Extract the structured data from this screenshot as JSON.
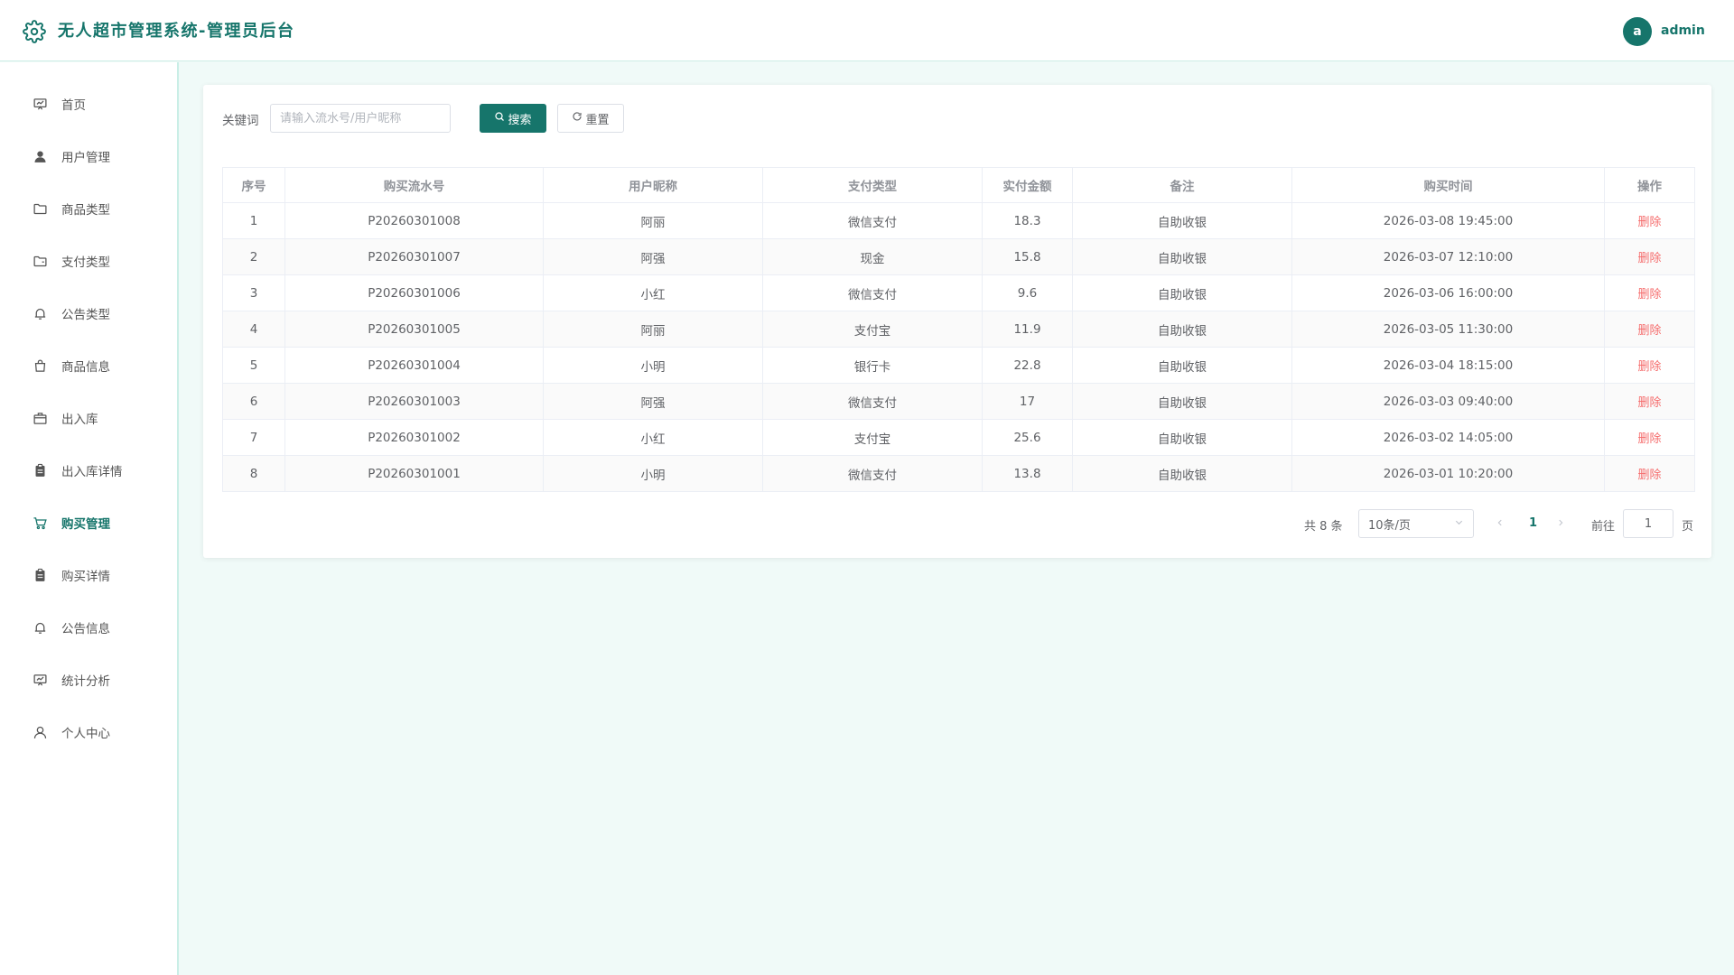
{
  "header": {
    "title": "无人超市管理系统-管理员后台",
    "avatar_letter": "a",
    "username": "admin"
  },
  "sidebar": {
    "items": [
      {
        "label": "首页",
        "icon": "presentation-board-icon"
      },
      {
        "label": "用户管理",
        "icon": "user-filled-icon"
      },
      {
        "label": "商品类型",
        "icon": "folder-icon"
      },
      {
        "label": "支付类型",
        "icon": "folder-opened-icon"
      },
      {
        "label": "公告类型",
        "icon": "bell-icon"
      },
      {
        "label": "商品信息",
        "icon": "shopping-bag-icon"
      },
      {
        "label": "出入库",
        "icon": "box-icon"
      },
      {
        "label": "出入库详情",
        "icon": "clipboard-icon"
      },
      {
        "label": "购买管理",
        "icon": "shopping-cart-icon",
        "active": true
      },
      {
        "label": "购买详情",
        "icon": "clipboard-icon"
      },
      {
        "label": "公告信息",
        "icon": "bell-icon"
      },
      {
        "label": "统计分析",
        "icon": "presentation-board-icon"
      },
      {
        "label": "个人中心",
        "icon": "user-icon"
      }
    ]
  },
  "search": {
    "label": "关键词",
    "placeholder": "请输入流水号/用户昵称",
    "value": "",
    "search_label": "搜索",
    "reset_label": "重置"
  },
  "table": {
    "headers": [
      "序号",
      "购买流水号",
      "用户昵称",
      "支付类型",
      "实付金额",
      "备注",
      "购买时间",
      "操作"
    ],
    "rows": [
      {
        "no": "1",
        "serial": "P20260301008",
        "nickname": "阿丽",
        "pay_type": "微信支付",
        "amount": "18.3",
        "remark": "自助收银",
        "time": "2026-03-08 19:45:00",
        "action": "删除"
      },
      {
        "no": "2",
        "serial": "P20260301007",
        "nickname": "阿强",
        "pay_type": "现金",
        "amount": "15.8",
        "remark": "自助收银",
        "time": "2026-03-07 12:10:00",
        "action": "删除"
      },
      {
        "no": "3",
        "serial": "P20260301006",
        "nickname": "小红",
        "pay_type": "微信支付",
        "amount": "9.6",
        "remark": "自助收银",
        "time": "2026-03-06 16:00:00",
        "action": "删除"
      },
      {
        "no": "4",
        "serial": "P20260301005",
        "nickname": "阿丽",
        "pay_type": "支付宝",
        "amount": "11.9",
        "remark": "自助收银",
        "time": "2026-03-05 11:30:00",
        "action": "删除"
      },
      {
        "no": "5",
        "serial": "P20260301004",
        "nickname": "小明",
        "pay_type": "银行卡",
        "amount": "22.8",
        "remark": "自助收银",
        "time": "2026-03-04 18:15:00",
        "action": "删除"
      },
      {
        "no": "6",
        "serial": "P20260301003",
        "nickname": "阿强",
        "pay_type": "微信支付",
        "amount": "17",
        "remark": "自助收银",
        "time": "2026-03-03 09:40:00",
        "action": "删除"
      },
      {
        "no": "7",
        "serial": "P20260301002",
        "nickname": "小红",
        "pay_type": "支付宝",
        "amount": "25.6",
        "remark": "自助收银",
        "time": "2026-03-02 14:05:00",
        "action": "删除"
      },
      {
        "no": "8",
        "serial": "P20260301001",
        "nickname": "小明",
        "pay_type": "微信支付",
        "amount": "13.8",
        "remark": "自助收银",
        "time": "2026-03-01 10:20:00",
        "action": "删除"
      }
    ]
  },
  "pagination": {
    "total_text": "共 8 条",
    "page_size": "10条/页",
    "current_page": "1",
    "goto_label": "前往",
    "goto_value": "1",
    "page_suffix": "页"
  },
  "colors": {
    "primary": "#16756b",
    "danger": "#f56c6c",
    "background": "#f0faf8"
  }
}
